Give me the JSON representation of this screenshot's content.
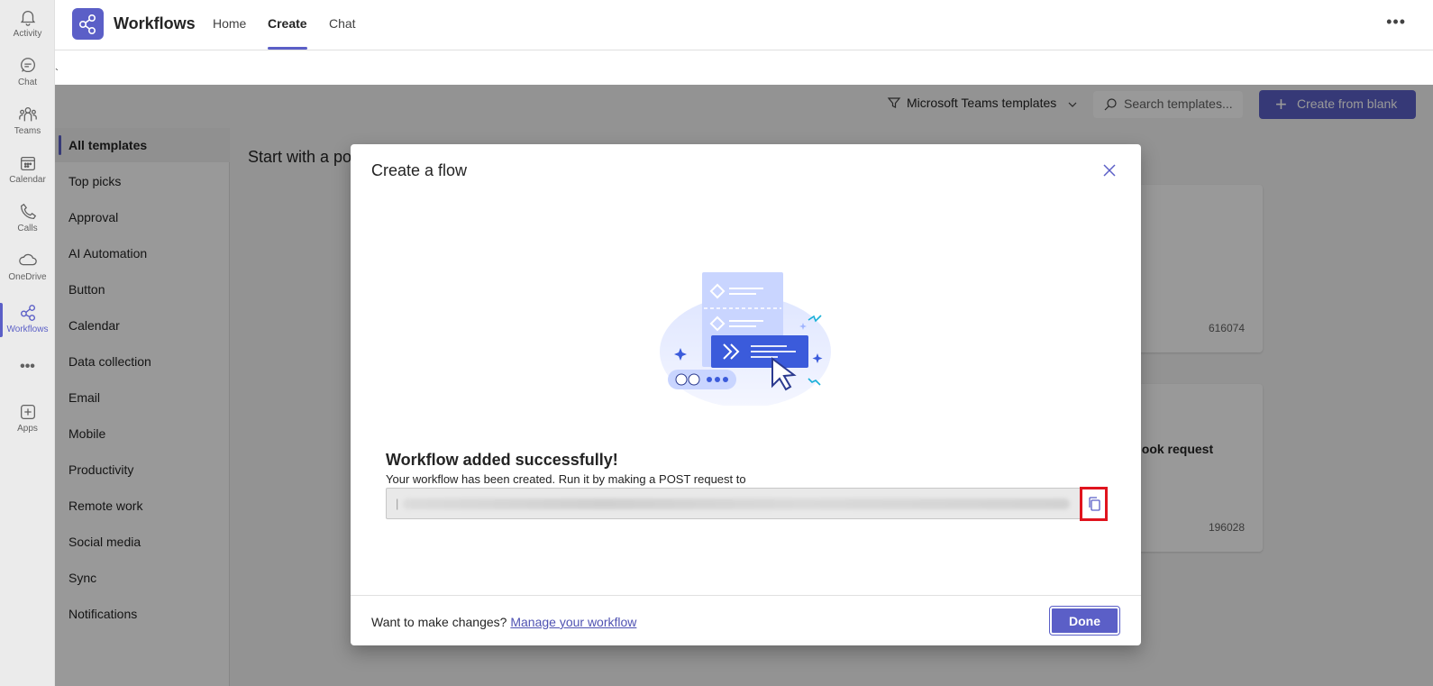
{
  "app": {
    "title": "Workflows",
    "tabs": [
      {
        "label": "Home"
      },
      {
        "label": "Create"
      },
      {
        "label": "Chat"
      }
    ],
    "active_tab": "Create",
    "more_label": "•••",
    "tick": "`"
  },
  "rail": {
    "items": [
      {
        "label": "Activity",
        "icon": "bell-icon"
      },
      {
        "label": "Chat",
        "icon": "chat-icon"
      },
      {
        "label": "Teams",
        "icon": "teams-icon"
      },
      {
        "label": "Calendar",
        "icon": "calendar-icon"
      },
      {
        "label": "Calls",
        "icon": "phone-icon"
      },
      {
        "label": "OneDrive",
        "icon": "cloud-icon"
      },
      {
        "label": "Workflows",
        "icon": "workflows-icon"
      },
      {
        "label": "Apps",
        "icon": "add-app-icon"
      }
    ],
    "more_label": "•••",
    "active": "Workflows"
  },
  "toolbar": {
    "filter_label": "Microsoft Teams templates",
    "search_placeholder": "Search templates...",
    "create_label": "Create from blank"
  },
  "categories": [
    "All templates",
    "Top picks",
    "Approval",
    "AI Automation",
    "Button",
    "Calendar",
    "Data collection",
    "Email",
    "Mobile",
    "Productivity",
    "Remote work",
    "Social media",
    "Sync",
    "Notifications"
  ],
  "main": {
    "section_title": "Start with a po",
    "cards": [
      {
        "title": "",
        "count": "616074"
      },
      {
        "title": "webhook request",
        "count": "196028"
      }
    ]
  },
  "dialog": {
    "title": "Create a flow",
    "success_title": "Workflow added successfully!",
    "success_desc": "Your workflow has been created. Run it by making a POST request to",
    "url_value": "|",
    "footer_question": "Want to make changes?",
    "manage_link": "Manage your workflow",
    "done_label": "Done"
  },
  "colors": {
    "accent": "#5b5fc7",
    "highlight": "#e0141e"
  }
}
